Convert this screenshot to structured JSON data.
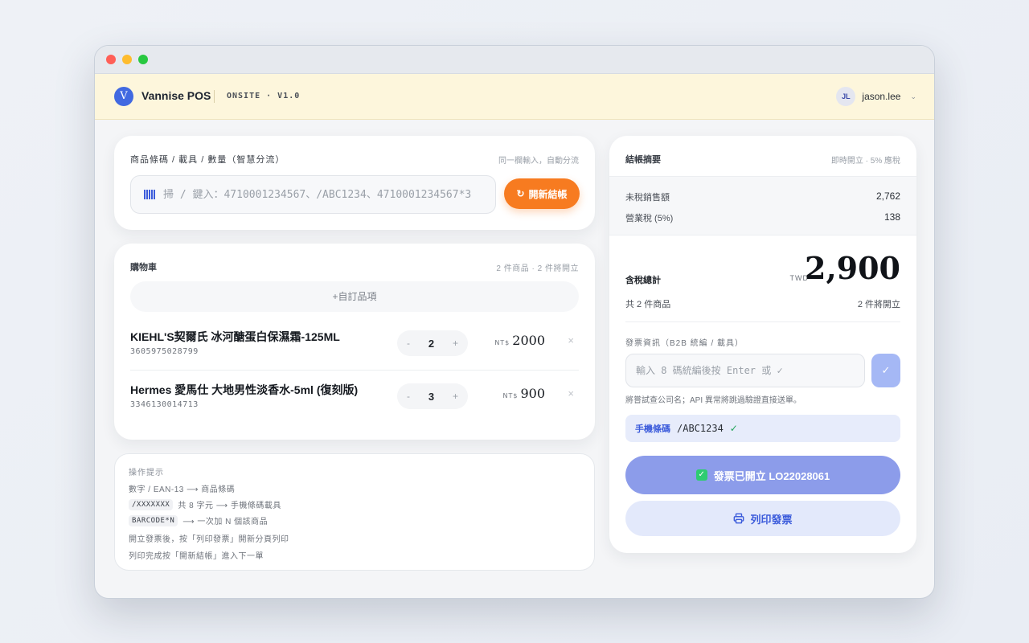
{
  "window": {
    "controls": [
      "close",
      "minimize",
      "maximize"
    ]
  },
  "app": {
    "logo_letter": "V",
    "name": "Vannise POS",
    "version": "ONSITE · V1.0",
    "user": {
      "initials": "JL",
      "name": "jason.lee",
      "chevron": "⌄"
    }
  },
  "scan": {
    "label": "商品條碼 / 載具 / 數量（智慧分流）",
    "hint": "同一欄輸入，自動分流",
    "placeholder": "掃 / 鍵入：4710001234567、/ABC1234、4710001234567*3",
    "new_button": "開新結帳",
    "new_icon": "↻"
  },
  "cart": {
    "title": "購物車",
    "meta": "2 件商品 · 2 件將開立",
    "custom_item": "+自訂品項",
    "currency": "NT$",
    "items": [
      {
        "name": "KIEHL'S契爾氏 冰河醣蛋白保濕霜-125ML",
        "code": "3605975028799",
        "qty": "2",
        "price": "2000",
        "minus": "-",
        "plus": "+",
        "remove": "×"
      },
      {
        "name": "Hermes 愛馬仕 大地男性淡香水-5ml (復刻版)",
        "code": "3346130014713",
        "qty": "3",
        "price": "900",
        "minus": "-",
        "plus": "+",
        "remove": "×"
      }
    ]
  },
  "tips": {
    "title": "操作提示",
    "lines": [
      {
        "code": "",
        "text": "數字 / EAN-13 ⟶ 商品條碼"
      },
      {
        "code": "/XXXXXXX",
        "text": "共 8 字元 ⟶ 手機條碼載具"
      },
      {
        "code": "BARCODE*N",
        "text": "⟶ 一次加 N 個該商品"
      },
      {
        "code": "",
        "text": "開立發票後，按「列印發票」開新分頁列印"
      },
      {
        "code": "",
        "text": "列印完成按「開新結帳」進入下一單"
      }
    ]
  },
  "summary": {
    "title": "結帳摘要",
    "hint": "即時開立 · 5% 應稅",
    "untaxed_label": "未稅銷售額",
    "untaxed_value": "2,762",
    "tax_label": "營業稅 (5%)",
    "tax_value": "138",
    "total_label": "含稅總計",
    "total_currency": "TWD",
    "total_value": "2,900",
    "count_left": "共 2 件商品",
    "count_right": "2 件將開立",
    "invoice_label": "發票資訊（B2B 統編 / 載具）",
    "tax_id_placeholder": "輸入 8 碼統編後按 Enter 或 ✓",
    "tax_id_button": "✓",
    "tax_note": "將嘗試查公司名；API 異常將跳過驗證直接送單。",
    "carrier_tag": "手機條碼",
    "carrier_value": "/ABC1234",
    "carrier_ok": "✓",
    "issued_button": "發票已開立 LO22028061",
    "issued_check": "✓",
    "print_button": "列印發票"
  },
  "colors": {
    "accent": "#3b5bdb",
    "orange": "#f77b20",
    "appbar_bg": "#fdf6dc",
    "issued_bg": "#8c9cea",
    "success": "#22a55a"
  },
  "icons": [
    "barcode-icon",
    "refresh-icon",
    "printer-icon",
    "check-icon",
    "close-icon",
    "chevron-down-icon"
  ]
}
